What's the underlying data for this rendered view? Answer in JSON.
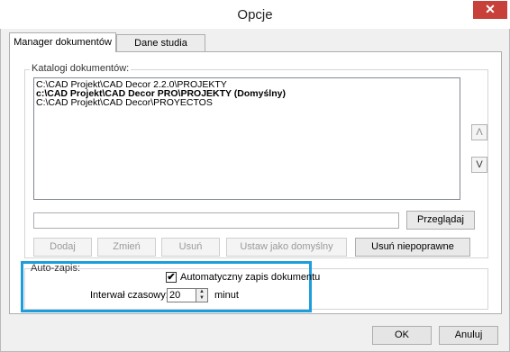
{
  "window": {
    "title": "Opcje",
    "close_symbol": "✕"
  },
  "tabs": [
    {
      "label": "Manager dokumentów",
      "active": true
    },
    {
      "label": "Dane studia",
      "active": false
    }
  ],
  "catalogs": {
    "group_label": "Katalogi dokumentów:",
    "items": [
      {
        "text": "C:\\CAD Projekt\\CAD Decor 2.2.0\\PROJEKTY",
        "bold": false
      },
      {
        "text": "c:\\CAD Projekt\\CAD Decor PRO\\PROJEKTY  (Domyślny)",
        "bold": true
      },
      {
        "text": "C:\\CAD Projekt\\CAD Decor\\PROYECTOS",
        "bold": false
      }
    ],
    "up_symbol": "Λ",
    "down_symbol": "V",
    "path_value": "",
    "browse_label": "Przeglądaj",
    "add_label": "Dodaj",
    "change_label": "Zmień",
    "remove_label": "Usuń",
    "set_default_label": "Ustaw jako domyślny",
    "remove_invalid_label": "Usuń niepoprawne"
  },
  "autosave": {
    "group_label": "Auto-zapis:",
    "checkbox_label": "Automatyczny zapis dokumentu",
    "checked": true,
    "interval_label": "Interwał czasowy:",
    "interval_value": "20",
    "unit_label": "minut"
  },
  "footer": {
    "ok_label": "OK",
    "cancel_label": "Anuluj"
  },
  "colors": {
    "highlight": "#1e9ddc",
    "close_button": "#c7413a"
  }
}
